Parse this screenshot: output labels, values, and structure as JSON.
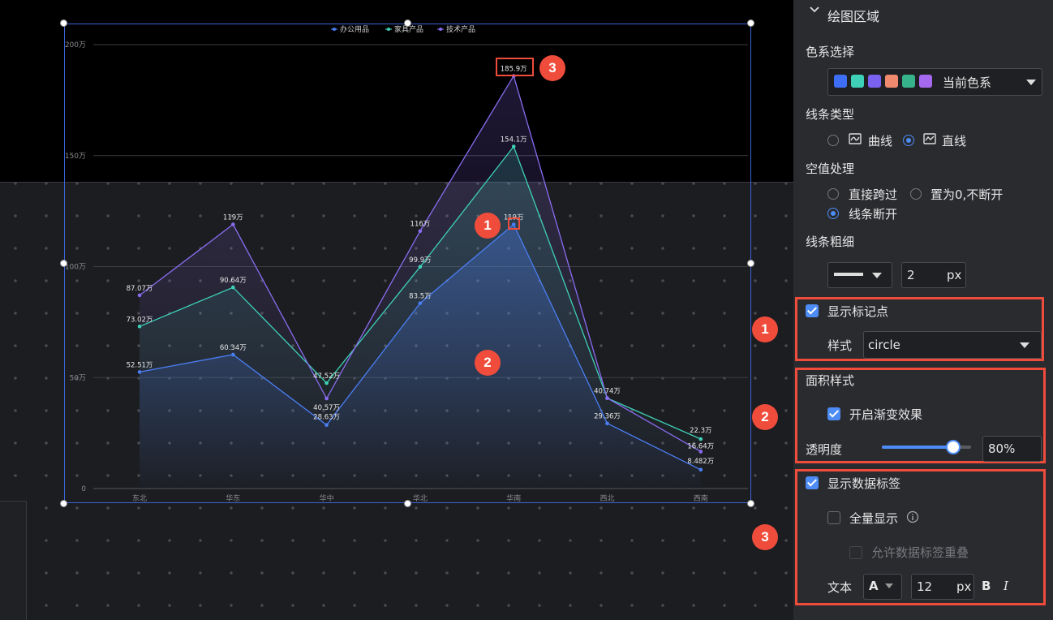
{
  "chart_data": {
    "type": "line",
    "categories": [
      "东北",
      "华东",
      "华中",
      "华北",
      "华南",
      "西北",
      "西南"
    ],
    "series": [
      {
        "name": "办公用品",
        "values": [
          52.51,
          60.34,
          28.63,
          83.5,
          119,
          29.36,
          8.482
        ],
        "labels": [
          "52.51万",
          "60.34万",
          "28.63万",
          "83.5万",
          "119万",
          "29.36万",
          "8.482万"
        ],
        "color": "#4a7ef5"
      },
      {
        "name": "家具产品",
        "values": [
          73.02,
          90.64,
          47.52,
          99.9,
          154.1,
          40.74,
          22.3
        ],
        "labels": [
          "73.02万",
          "90.64万",
          "47.52万",
          "99.9万",
          "154.1万",
          "40.74万",
          "22.3万"
        ],
        "color": "#3ed1b8"
      },
      {
        "name": "技术产品",
        "values": [
          87.07,
          119,
          40.57,
          116,
          185.9,
          40.74,
          16.64
        ],
        "labels": [
          "87.07万",
          "119万",
          "40.57万",
          "116万",
          "185.9万",
          "",
          "16.64万"
        ],
        "color": "#8a6cf0"
      }
    ],
    "yticks": [
      "0",
      "50万",
      "100万",
      "150万",
      "200万"
    ],
    "ylim": [
      0,
      200
    ],
    "legend_position": "top-center",
    "grid": true,
    "area": true
  },
  "callouts": [
    "1",
    "2",
    "3"
  ],
  "panel": {
    "section_title": "绘图区域",
    "color_scheme_label": "色系选择",
    "color_scheme_value": "当前色系",
    "swatches": [
      "#3d6ef5",
      "#3ed1b8",
      "#7b61f0",
      "#f08a6e",
      "#36b38a",
      "#a569f0"
    ],
    "line_type_label": "线条类型",
    "line_type_curve": "曲线",
    "line_type_straight": "直线",
    "null_label": "空值处理",
    "null_skip": "直接跨过",
    "null_zero": "置为0,不断开",
    "null_break": "线条断开",
    "line_width_label": "线条粗细",
    "line_width_value": "2",
    "line_width_unit": "px",
    "show_marker": "显示标记点",
    "marker_style_label": "样式",
    "marker_style_value": "circle",
    "area_style_title": "面积样式",
    "gradient": "开启渐变效果",
    "opacity_label": "透明度",
    "opacity_value": "80%",
    "opacity_fraction": 0.8,
    "show_labels": "显示数据标签",
    "show_all": "全量显示",
    "allow_overlap": "允许数据标签重叠",
    "text_label": "文本",
    "font_glyph": "A",
    "font_size": "12",
    "font_unit": "px",
    "bold": "B",
    "italic": "I"
  }
}
